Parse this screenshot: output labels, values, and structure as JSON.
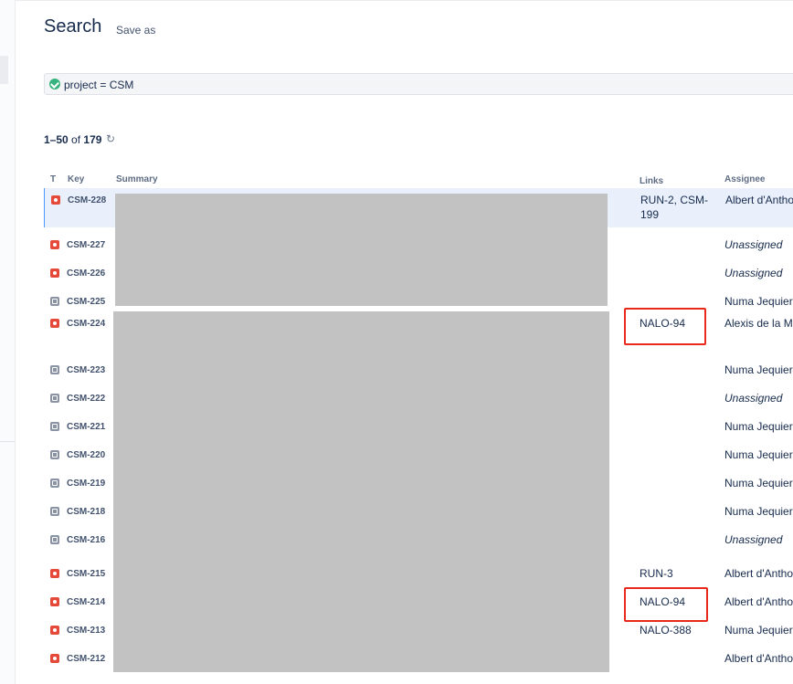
{
  "header": {
    "title": "Search",
    "save_as": "Save as"
  },
  "jql": {
    "query": "project = CSM"
  },
  "results": {
    "range": "1–50",
    "of": "of",
    "total": "179"
  },
  "columns": {
    "type": "T",
    "key": "Key",
    "summary": "Summary",
    "links": "Links",
    "assignee": "Assignee"
  },
  "rows": [
    {
      "type": "bug",
      "key": "CSM-228",
      "links": "RUN-2, CSM-199",
      "assignee": "Albert d'Antho",
      "unassigned": false
    },
    {
      "type": "bug",
      "key": "CSM-227",
      "links": "",
      "assignee": "Unassigned",
      "unassigned": true
    },
    {
      "type": "bug",
      "key": "CSM-226",
      "links": "",
      "assignee": "Unassigned",
      "unassigned": true
    },
    {
      "type": "task",
      "key": "CSM-225",
      "links": "",
      "assignee": "Numa Jequier",
      "unassigned": false
    },
    {
      "type": "bug",
      "key": "CSM-224",
      "links": "NALO-94",
      "assignee": "Alexis de la Mo",
      "unassigned": false
    },
    {
      "type": "task",
      "key": "CSM-223",
      "links": "",
      "assignee": "Numa Jequier",
      "unassigned": false
    },
    {
      "type": "task",
      "key": "CSM-222",
      "links": "",
      "assignee": "Unassigned",
      "unassigned": true
    },
    {
      "type": "task",
      "key": "CSM-221",
      "links": "",
      "assignee": "Numa Jequier",
      "unassigned": false
    },
    {
      "type": "task",
      "key": "CSM-220",
      "links": "",
      "assignee": "Numa Jequier",
      "unassigned": false
    },
    {
      "type": "task",
      "key": "CSM-219",
      "links": "",
      "assignee": "Numa Jequier",
      "unassigned": false
    },
    {
      "type": "task",
      "key": "CSM-218",
      "links": "",
      "assignee": "Numa Jequier",
      "unassigned": false
    },
    {
      "type": "task",
      "key": "CSM-216",
      "links": "",
      "assignee": "Unassigned",
      "unassigned": true
    },
    {
      "type": "bug",
      "key": "CSM-215",
      "links": "RUN-3",
      "assignee": "Albert d'Antho",
      "unassigned": false
    },
    {
      "type": "bug",
      "key": "CSM-214",
      "links": "NALO-94",
      "assignee": "Albert d'Antho",
      "unassigned": false
    },
    {
      "type": "bug",
      "key": "CSM-213",
      "links": "NALO-388",
      "assignee": "Numa Jequier",
      "unassigned": false
    },
    {
      "type": "bug",
      "key": "CSM-212",
      "links": "",
      "assignee": "Albert d'Antho",
      "unassigned": false
    }
  ],
  "colors": {
    "bug": "#e5493a",
    "task": "#8993a4",
    "highlight": "#e8291b",
    "redaction": "#c2c2c2"
  }
}
